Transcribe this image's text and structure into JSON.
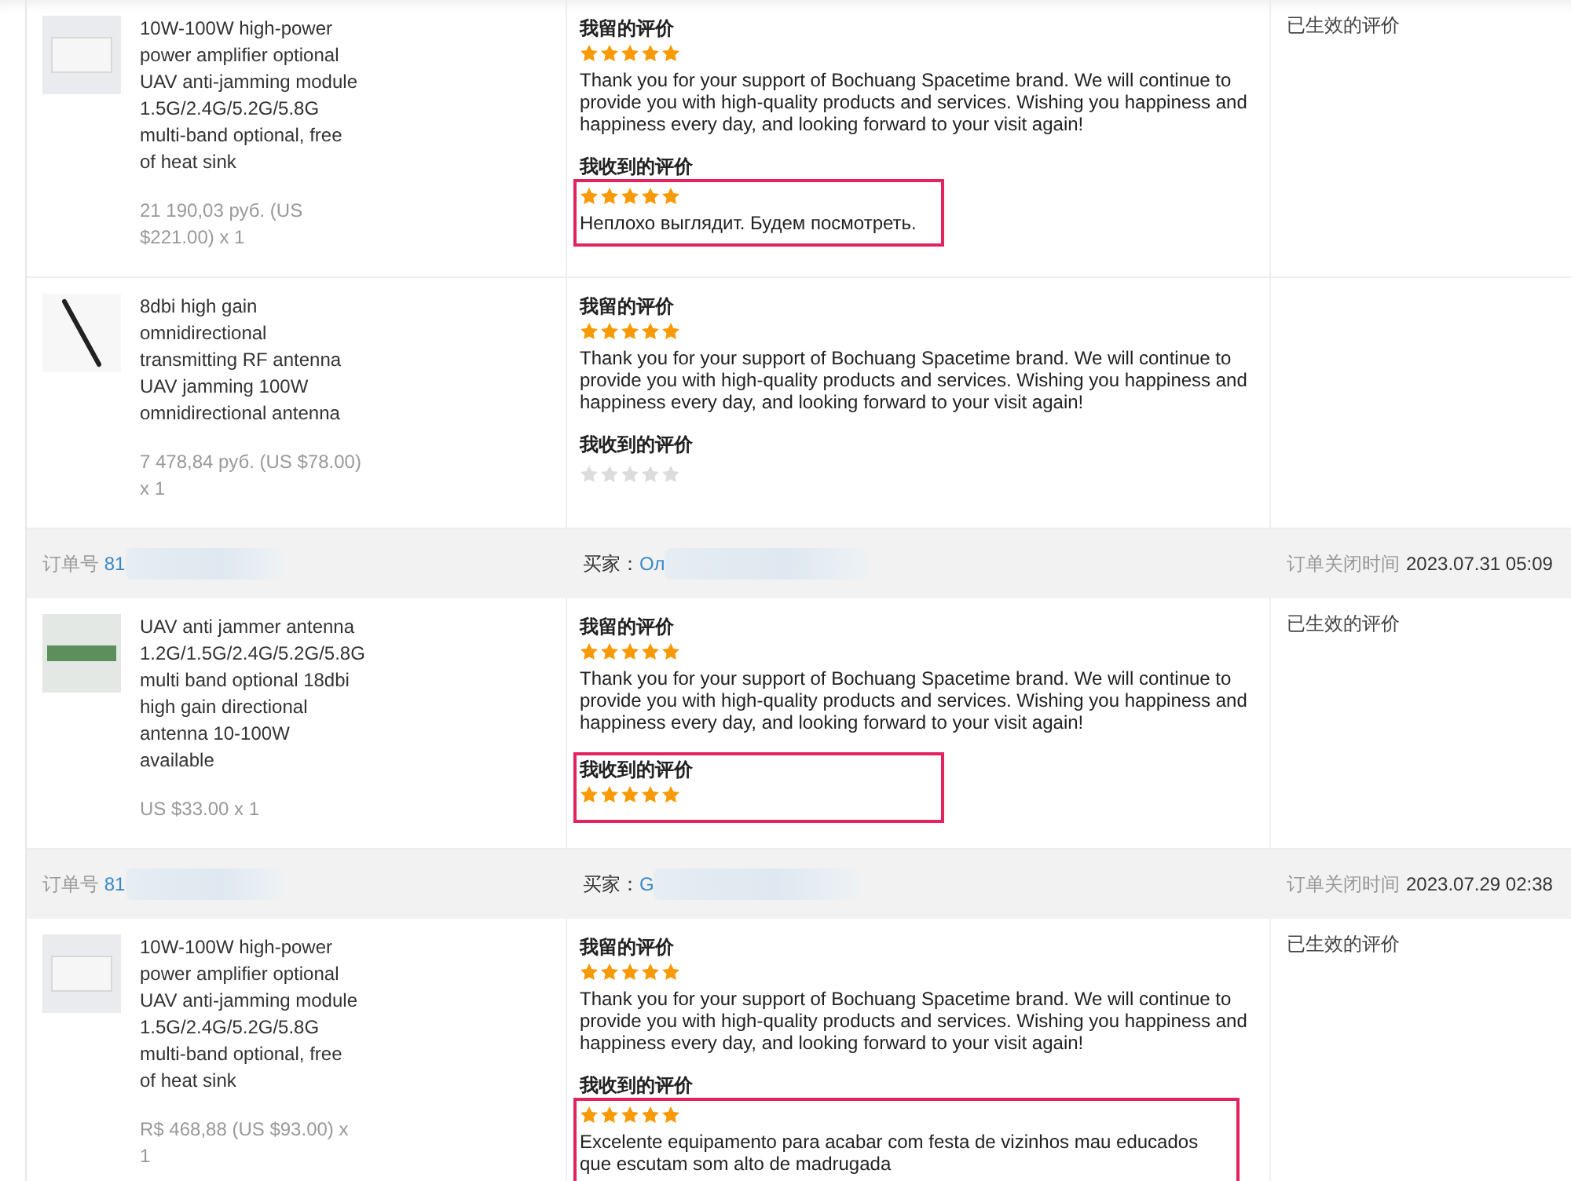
{
  "rows": [
    {
      "kind": "product",
      "name": "10W-100W high-power power amplifier optional UAV anti-jamming module 1.5G/2.4G/5.2G/5.8G multi-band optional, free of heat sink",
      "price": "21 190,03 руб. (US $221.00) x 1",
      "my_review": {
        "title": "我留的评价",
        "stars": 5,
        "text": "Thank you for your support of Bochuang Spacetime brand. We will continue to provide you with high-quality products and services. Wishing you happiness and happiness every day, and looking forward to your visit again!"
      },
      "received": {
        "title": "我收到的评价",
        "stars": 5,
        "text": "Неплохо выглядит. Будем посмотреть.",
        "highlighted": true,
        "highlight_title": false
      },
      "status": "已生效的评价"
    },
    {
      "kind": "product",
      "name": "8dbi high gain omnidirectional transmitting RF antenna UAV jamming 100W omnidirectional antenna",
      "price": "7 478,84 руб. (US $78.00) x 1",
      "my_review": {
        "title": "我留的评价",
        "stars": 5,
        "text": "Thank you for your support of Bochuang Spacetime brand. We will continue to provide you with high-quality products and services. Wishing you happiness and happiness every day, and looking forward to your visit again!"
      },
      "received": {
        "title": "我收到的评价",
        "stars": 0,
        "highlighted": false,
        "highlight_title": false
      }
    },
    {
      "kind": "header",
      "order_label": "订单号",
      "order_no": "81",
      "buyer_label": "买家：",
      "buyer": "Ол",
      "closed_label": "订单关闭时间",
      "closed_time": "2023.07.31 05:09"
    },
    {
      "kind": "product",
      "name": "UAV anti jammer antenna 1.2G/1.5G/2.4G/5.2G/5.8G multi band optional 18dbi high gain directional antenna 10-100W available",
      "price": "US $33.00 x 1",
      "my_review": {
        "title": "我留的评价",
        "stars": 5,
        "text": "Thank you for your support of Bochuang Spacetime brand. We will continue to provide you with high-quality products and services. Wishing you happiness and happiness every day, and looking forward to your visit again!"
      },
      "received": {
        "title": "我收到的评价",
        "stars": 5,
        "highlighted": true,
        "highlight_title": true
      },
      "status": "已生效的评价"
    },
    {
      "kind": "header",
      "order_label": "订单号",
      "order_no": "81",
      "buyer_label": "买家：",
      "buyer": "G",
      "closed_label": "订单关闭时间",
      "closed_time": "2023.07.29 02:38"
    },
    {
      "kind": "product",
      "name": "10W-100W high-power power amplifier optional UAV anti-jamming module 1.5G/2.4G/5.2G/5.8G multi-band optional, free of heat sink",
      "price": "R$ 468,88 (US $93.00) x 1",
      "my_review": {
        "title": "我留的评价",
        "stars": 5,
        "text": "Thank you for your support of Bochuang Spacetime brand. We will continue to provide you with high-quality products and services. Wishing you happiness and happiness every day, and looking forward to your visit again!"
      },
      "received": {
        "title": "我收到的评价",
        "stars": 5,
        "text": "Excelente equipamento para acabar com festa de vizinhos mau educados que escutam som alto de madrugada",
        "highlighted": true,
        "highlight_title": false
      },
      "status": "已生效的评价"
    }
  ]
}
